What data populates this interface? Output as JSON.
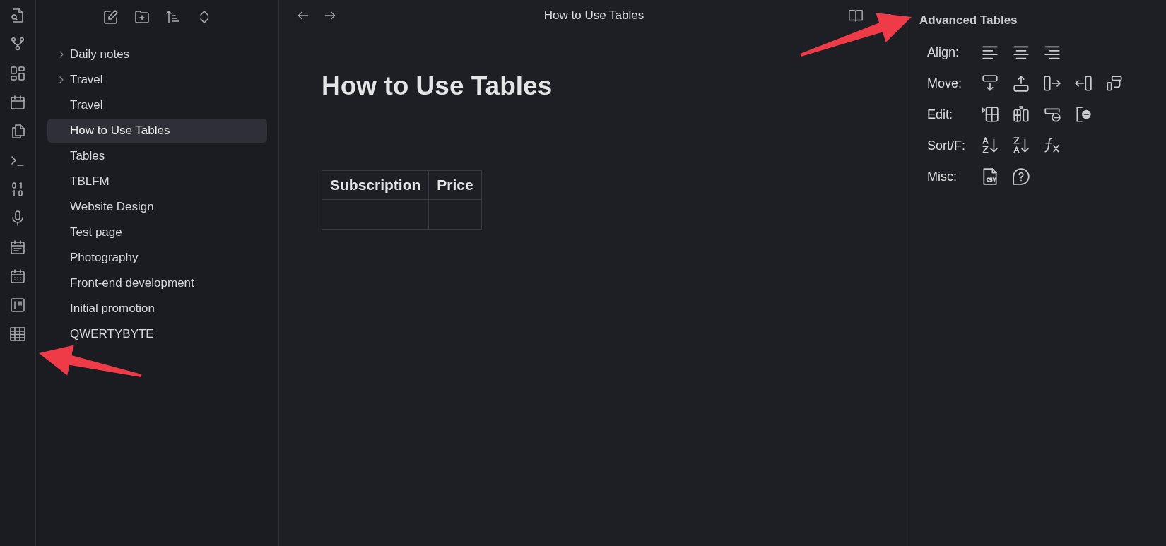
{
  "ribbon": {
    "items": [
      {
        "selected": false
      },
      {
        "selected": false
      },
      {
        "selected": false
      },
      {
        "selected": false
      },
      {
        "selected": false
      },
      {
        "selected": false
      },
      {
        "selected": false
      },
      {
        "selected": false
      },
      {
        "selected": false
      },
      {
        "selected": false
      },
      {
        "selected": false
      },
      {
        "selected": false
      }
    ]
  },
  "file_tree": {
    "items": [
      {
        "label": "Daily notes",
        "kind": "folder",
        "expanded": false,
        "selected": false
      },
      {
        "label": "Travel",
        "kind": "folder",
        "expanded": false,
        "selected": false
      },
      {
        "label": "Travel",
        "kind": "file",
        "selected": false
      },
      {
        "label": "How to Use Tables",
        "kind": "file",
        "selected": true
      },
      {
        "label": "Tables",
        "kind": "file",
        "selected": false
      },
      {
        "label": "TBLFM",
        "kind": "file",
        "selected": false
      },
      {
        "label": "Website Design",
        "kind": "file",
        "selected": false
      },
      {
        "label": "Test page",
        "kind": "file",
        "selected": false
      },
      {
        "label": "Photography",
        "kind": "file",
        "selected": false
      },
      {
        "label": "Front-end development",
        "kind": "file",
        "selected": false
      },
      {
        "label": "Initial promotion",
        "kind": "file",
        "selected": false
      },
      {
        "label": "QWERTYBYTE",
        "kind": "file",
        "selected": false
      }
    ]
  },
  "editor": {
    "tab_title": "How to Use Tables",
    "heading": "How to Use Tables",
    "table": {
      "columns": [
        "Subscription",
        "Price"
      ],
      "rows": [
        [
          "",
          ""
        ]
      ]
    }
  },
  "advanced_tables": {
    "title": "Advanced Tables",
    "rows": [
      {
        "label": "Align:"
      },
      {
        "label": "Move:"
      },
      {
        "label": "Edit:"
      },
      {
        "label": "Sort/F:"
      },
      {
        "label": "Misc:"
      }
    ]
  },
  "annotations": [
    {
      "kind": "arrow"
    },
    {
      "kind": "arrow"
    }
  ]
}
